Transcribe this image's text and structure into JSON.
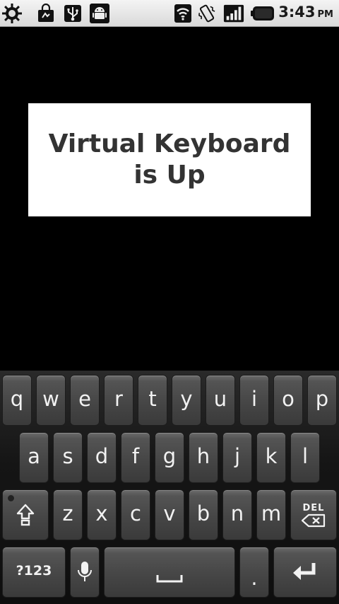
{
  "status_bar": {
    "left_icons": [
      "brightness-icon",
      "shopping-bag-icon",
      "usb-icon",
      "android-debug-icon"
    ],
    "right_icons": [
      "wifi-icon",
      "vibrate-icon",
      "signal-icon",
      "battery-icon"
    ],
    "time": "3:43",
    "ampm": "PM"
  },
  "app": {
    "message": "Virtual Keyboard is Up"
  },
  "keyboard": {
    "row1": [
      "q",
      "w",
      "e",
      "r",
      "t",
      "y",
      "u",
      "i",
      "o",
      "p"
    ],
    "row2": [
      "a",
      "s",
      "d",
      "f",
      "g",
      "h",
      "j",
      "k",
      "l"
    ],
    "row3": [
      "z",
      "x",
      "c",
      "v",
      "b",
      "n",
      "m"
    ],
    "shift_icon": "shift-arrow-icon",
    "delete_label": "DEL",
    "symbols_label": "?123",
    "mic_icon": "microphone-icon",
    "space_icon": "space-bar-icon",
    "period_label": ".",
    "enter_icon": "enter-arrow-icon"
  }
}
